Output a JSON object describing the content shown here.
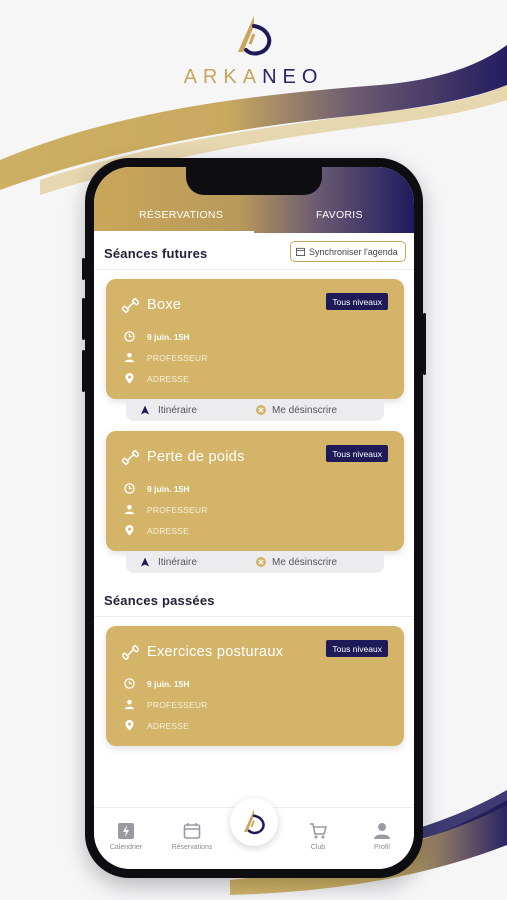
{
  "brand": {
    "name_part1": "ARKA",
    "name_part2": "NEO"
  },
  "tabs": [
    {
      "label": "RÉSERVATIONS",
      "active": true
    },
    {
      "label": "FAVORIS",
      "active": false
    }
  ],
  "upcoming": {
    "title": "Séances futures",
    "sync_label": "Synchroniser l'agenda",
    "sessions": [
      {
        "name": "Boxe",
        "level": "Tous niveaux",
        "date": "9 juin. 15H",
        "teacher": "PROFESSEUR",
        "address": "ADRESSE"
      },
      {
        "name": "Perte de poids",
        "level": "Tous niveaux",
        "date": "9 juin. 15H",
        "teacher": "PROFESSEUR",
        "address": "ADRESSE"
      }
    ],
    "actions": {
      "itinerary": "Itinéraire",
      "unsubscribe": "Me désinscrire"
    }
  },
  "past": {
    "title": "Séances passées",
    "sessions": [
      {
        "name": "Exercices posturaux",
        "level": "Tous niveaux",
        "date": "9 juin. 15H",
        "teacher": "PROFESSEUR",
        "address": "ADRESSE"
      }
    ]
  },
  "nav": [
    {
      "label": "Calendrier",
      "icon": "lightning-icon"
    },
    {
      "label": "Réservations",
      "icon": "calendar-icon"
    },
    {
      "label": "",
      "icon": "logo-icon"
    },
    {
      "label": "Club",
      "icon": "cart-icon"
    },
    {
      "label": "Profil",
      "icon": "person-icon"
    }
  ],
  "colors": {
    "gold": "#d4b468",
    "navy": "#1e1a57",
    "brand_gold": "#c8a55b"
  }
}
